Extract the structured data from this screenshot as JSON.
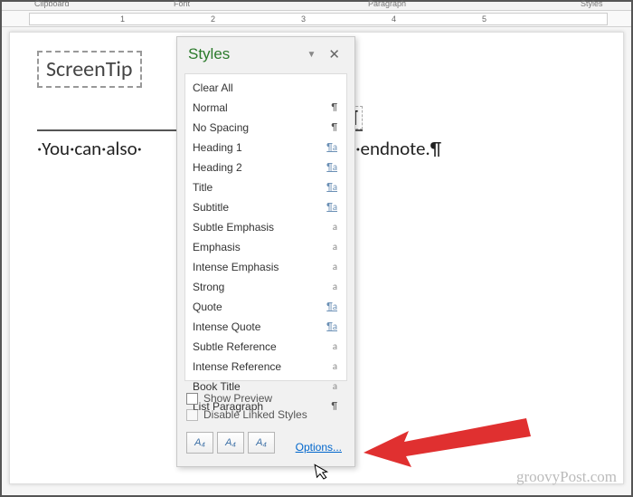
{
  "ribbon": {
    "l1": "Clipboard",
    "l2": "Font",
    "l3": "Paragraph",
    "l4": "Styles"
  },
  "ruler": {
    "n1": "1",
    "n2": "2",
    "n3": "3",
    "n4": "4",
    "n5": "5"
  },
  "doc": {
    "tip": "ScreenTip",
    "hidden_text_before": "·You·can·also·",
    "hidden_text_after": "g·an·endnote.¶",
    "pilcrow": "¶"
  },
  "pane": {
    "title": "Styles",
    "entries": [
      {
        "label": "Clear All",
        "mark": "",
        "cls": ""
      },
      {
        "label": "Normal",
        "mark": "¶",
        "cls": "para"
      },
      {
        "label": "No Spacing",
        "mark": "¶",
        "cls": "para"
      },
      {
        "label": "Heading 1",
        "mark": "¶a",
        "cls": ""
      },
      {
        "label": "Heading 2",
        "mark": "¶a",
        "cls": ""
      },
      {
        "label": "Title",
        "mark": "¶a",
        "cls": ""
      },
      {
        "label": "Subtitle",
        "mark": "¶a",
        "cls": ""
      },
      {
        "label": "Subtle Emphasis",
        "mark": "a",
        "cls": "plain"
      },
      {
        "label": "Emphasis",
        "mark": "a",
        "cls": "plain"
      },
      {
        "label": "Intense Emphasis",
        "mark": "a",
        "cls": "plain"
      },
      {
        "label": "Strong",
        "mark": "a",
        "cls": "plain"
      },
      {
        "label": "Quote",
        "mark": "¶a",
        "cls": ""
      },
      {
        "label": "Intense Quote",
        "mark": "¶a",
        "cls": ""
      },
      {
        "label": "Subtle Reference",
        "mark": "a",
        "cls": "plain"
      },
      {
        "label": "Intense Reference",
        "mark": "a",
        "cls": "plain"
      },
      {
        "label": "Book Title",
        "mark": "a",
        "cls": "plain"
      },
      {
        "label": "List Paragraph",
        "mark": "¶",
        "cls": "para"
      }
    ],
    "show_preview": "Show Preview",
    "disable_linked": "Disable Linked Styles",
    "btn1": "A₄",
    "btn2": "A₄",
    "btn3": "A₄",
    "options": "Options..."
  },
  "watermark": "groovyPost.com"
}
